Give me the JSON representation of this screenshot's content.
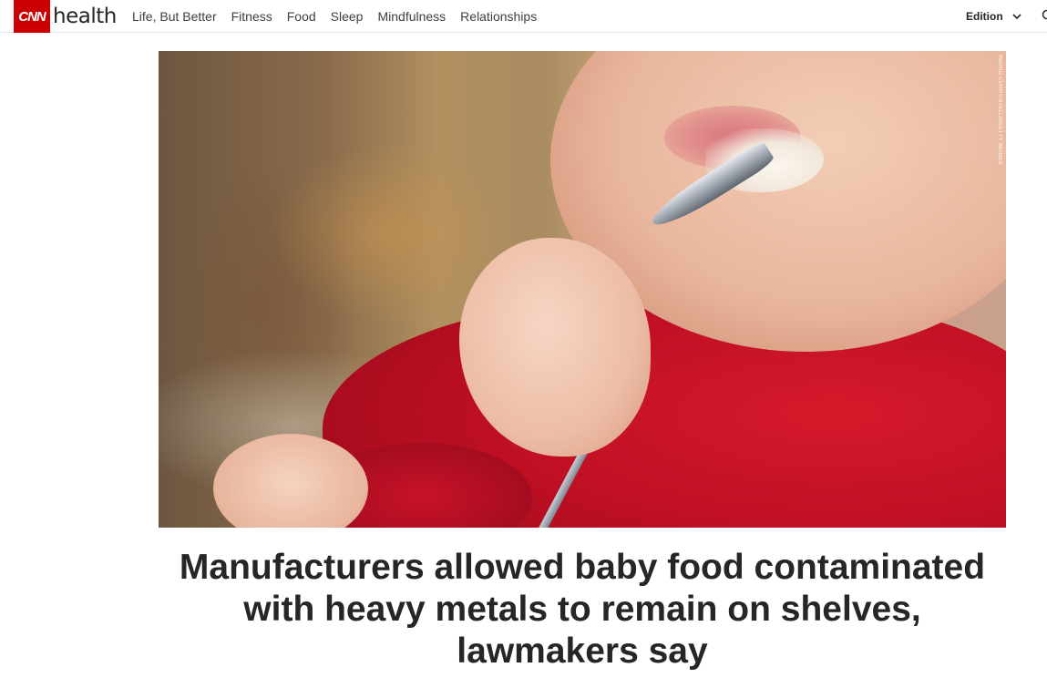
{
  "header": {
    "logo_text": "CNN",
    "section_name": "health",
    "brand_color": "#cc0000",
    "nav": [
      {
        "label": "Life, But Better"
      },
      {
        "label": "Fitness"
      },
      {
        "label": "Food"
      },
      {
        "label": "Sleep"
      },
      {
        "label": "Mindfulness"
      },
      {
        "label": "Relationships"
      }
    ],
    "edition_label": "Edition",
    "edition_icon": "chevron-down-icon",
    "search_icon": "search-icon"
  },
  "article": {
    "image_credit": "INGRID CURRY/STELLA/GETTY IMAGES",
    "headline": "Manufacturers allowed baby food contaminated with heavy metals to remain on shelves, lawmakers say"
  }
}
